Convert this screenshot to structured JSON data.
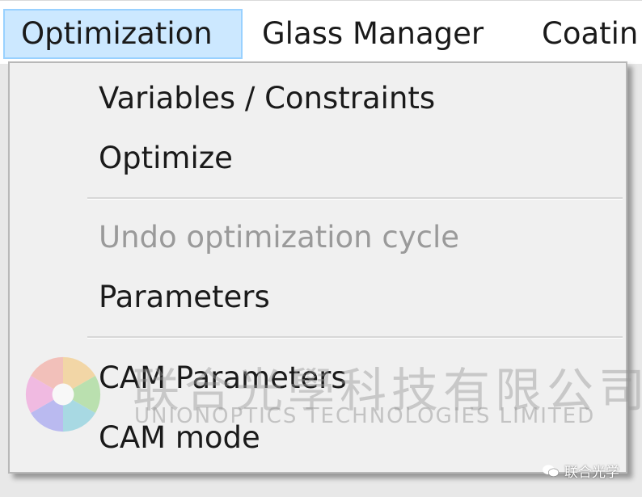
{
  "menubar": {
    "items": [
      {
        "label": "Optimization",
        "active": true
      },
      {
        "label": "Glass Manager",
        "active": false
      },
      {
        "label": "Coatin",
        "active": false
      }
    ]
  },
  "dropdown": {
    "items": [
      {
        "label": "Variables / Constraints",
        "enabled": true
      },
      {
        "label": "Optimize",
        "enabled": true
      },
      {
        "label": "Undo optimization cycle",
        "enabled": false
      },
      {
        "label": "Parameters",
        "enabled": true
      },
      {
        "label": "CAM Parameters",
        "enabled": true
      },
      {
        "label": "CAM mode",
        "enabled": true
      }
    ]
  },
  "watermark": {
    "cn": "联合光學科技有限公司",
    "en": "UNIONOPTICS TECHNOLOGIES LIMITED",
    "corner": "联合光学",
    "corner_icon": "wechat-icon",
    "logo_icon": "aperture-logo"
  },
  "colors": {
    "active_menu_bg": "#cce8ff",
    "active_menu_border": "#99d1ff",
    "dropdown_bg": "#f0f0f0",
    "disabled_text": "#9a9a9a"
  }
}
